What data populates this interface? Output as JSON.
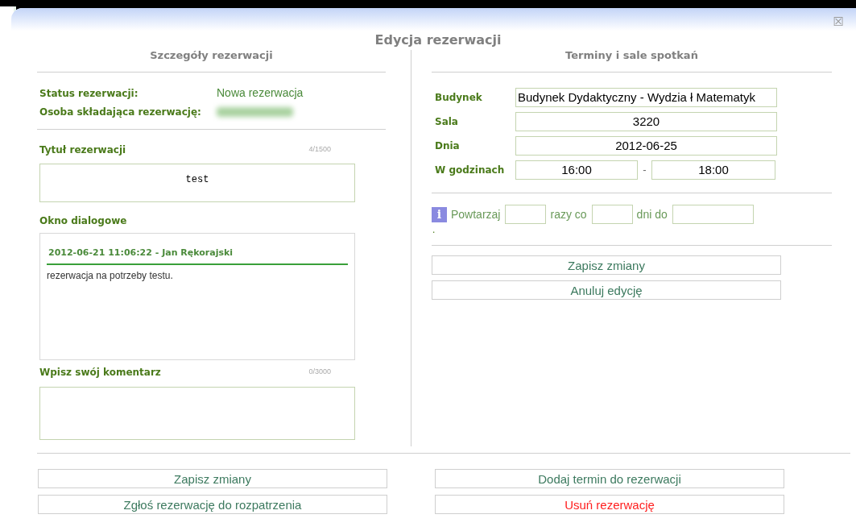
{
  "dialog": {
    "title": "Edycja rezerwacji",
    "close_label": "☒"
  },
  "details": {
    "heading": "Szczegóły rezerwacji",
    "info": [
      {
        "label": "Status rezerwacji:",
        "value": "Nowa rezerwacja",
        "redacted": false
      },
      {
        "label": "Osoba składająca rezerwację:",
        "redacted": true
      }
    ],
    "title_field": {
      "label": "Tytuł rezerwacji",
      "counter": "4/1500",
      "value": "test"
    },
    "messages": {
      "label": "Okno dialogowe",
      "items": [
        {
          "header": "2012-06-21 11:06:22 - Jan Rękorajski",
          "text": "rezerwacja na potrzeby testu."
        }
      ]
    },
    "comment_field": {
      "label": "Wpisz swój komentarz",
      "counter": "0/3000"
    }
  },
  "terms": {
    "heading": "Terminy i sale spotkań",
    "fields": [
      {
        "label": "Budynek",
        "value": "Budynek Dydaktyczny - Wydzia ł Matematyk",
        "kind": "select"
      },
      {
        "label": "Sala",
        "value": "3220",
        "kind": "text"
      },
      {
        "label": "Dnia",
        "value": "2012-06-25",
        "kind": "text"
      }
    ],
    "hours": {
      "label": "W godzinach",
      "from": "16:00",
      "separator": "-",
      "to": "18:00"
    },
    "repeat": {
      "info_icon": "i",
      "texts": [
        "Powtarzaj",
        "razy co",
        "dni do"
      ],
      "note": "."
    },
    "buttons": [
      {
        "label": "Zapisz zmiany",
        "kind": "normal"
      },
      {
        "label": "Anuluj edycję",
        "kind": "normal"
      }
    ]
  },
  "footer": {
    "left_buttons": [
      {
        "label": "Zapisz zmiany",
        "kind": "normal"
      },
      {
        "label": "Zgłoś rezerwację do rozpatrzenia",
        "kind": "normal"
      }
    ],
    "right_buttons": [
      {
        "label": "Dodaj termin do rezerwacji",
        "kind": "normal"
      },
      {
        "label": "Usuń rezerwację",
        "kind": "danger"
      }
    ]
  }
}
